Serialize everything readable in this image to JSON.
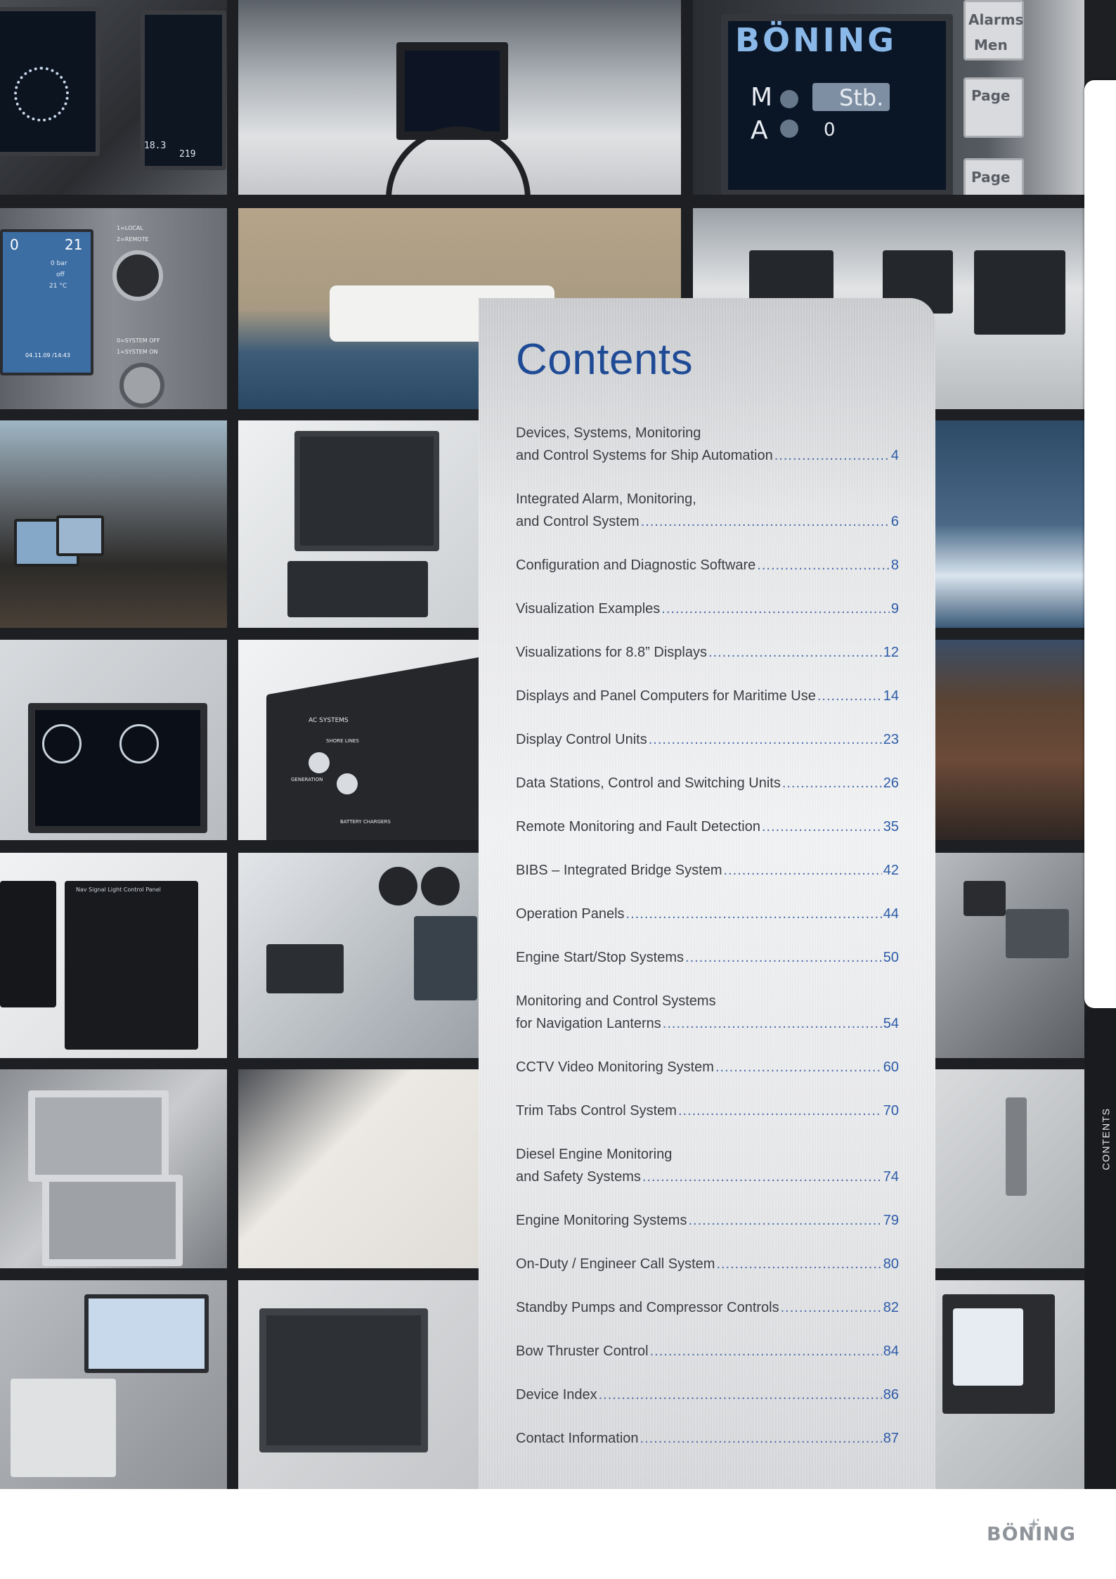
{
  "colors": {
    "title": "#1f4b96",
    "page_number": "#2c5ba8",
    "text": "#3a3d42"
  },
  "photo_screens": {
    "brand_display": "BÖNING",
    "m_label": "M",
    "a_label": "A",
    "stb_label": "Stb.",
    "zero_value": "0",
    "btn_alarms_1": "Alarms",
    "btn_alarms_2": "Men",
    "btn_page": "Page",
    "btn_page_2": "Page",
    "panel_left_value_1": "0",
    "panel_left_value_2": "21",
    "panel_left_row_1": "0 bar",
    "panel_left_row_2": "off",
    "panel_left_row_3": "21 °C",
    "local": "1=LOCAL",
    "remote": "2=REMOTE",
    "system_off": "0=SYSTEM OFF",
    "system_on": "1=SYSTEM ON",
    "panel_date": "04.11.09 /14:43",
    "ac_systems": "AC SYSTEMS",
    "shore_lines": "SHORE LINES",
    "generators": "GENERATION",
    "battery_chargers": "BATTERY CHARGERS",
    "light_panel_title": "Nav Signal Light Control Panel",
    "display_value_1": "18.3",
    "display_value_2": "219"
  },
  "side_tab": {
    "label": "CONTENTS"
  },
  "contents": {
    "title": "Contents",
    "entries": [
      {
        "line1": "Devices, Systems, Monitoring",
        "line2": "and Control Systems for Ship Automation",
        "page": "4"
      },
      {
        "line1": "Integrated Alarm, Monitoring,",
        "line2": "and Control System",
        "page": "6"
      },
      {
        "line2": "Configuration and Diagnostic Software",
        "page": "8"
      },
      {
        "line2": "Visualization Examples",
        "page": "9"
      },
      {
        "line2": "Visualizations for 8.8” Displays",
        "page": "12"
      },
      {
        "line2": "Displays and Panel Computers for Maritime Use",
        "page": "14"
      },
      {
        "line2": "Display Control Units",
        "page": "23"
      },
      {
        "line2": "Data Stations, Control and Switching Units",
        "page": "26"
      },
      {
        "line2": "Remote Monitoring and Fault Detection",
        "page": "35"
      },
      {
        "line2": "BIBS – Integrated Bridge System",
        "page": "42"
      },
      {
        "line2": "Operation Panels",
        "page": "44"
      },
      {
        "line2": "Engine Start/Stop Systems",
        "page": "50"
      },
      {
        "line1": "Monitoring and Control Systems",
        "line2": "for Navigation Lanterns",
        "page": "54"
      },
      {
        "line2": "CCTV Video Monitoring System",
        "page": "60"
      },
      {
        "line2": "Trim Tabs Control System",
        "page": "70"
      },
      {
        "line1": "Diesel Engine Monitoring",
        "line2": "and Safety Systems",
        "page": "74"
      },
      {
        "line2": "Engine Monitoring Systems",
        "page": "79"
      },
      {
        "line2": "On-Duty / Engineer Call System",
        "page": "80"
      },
      {
        "line2": "Standby Pumps and Compressor Controls",
        "page": "82"
      },
      {
        "line2": "Bow Thruster Control",
        "page": "84"
      },
      {
        "line2": "Device Index",
        "page": "86"
      },
      {
        "line2": "Contact Information",
        "page": "87"
      }
    ]
  },
  "footer": {
    "brand": "BÖNING"
  }
}
